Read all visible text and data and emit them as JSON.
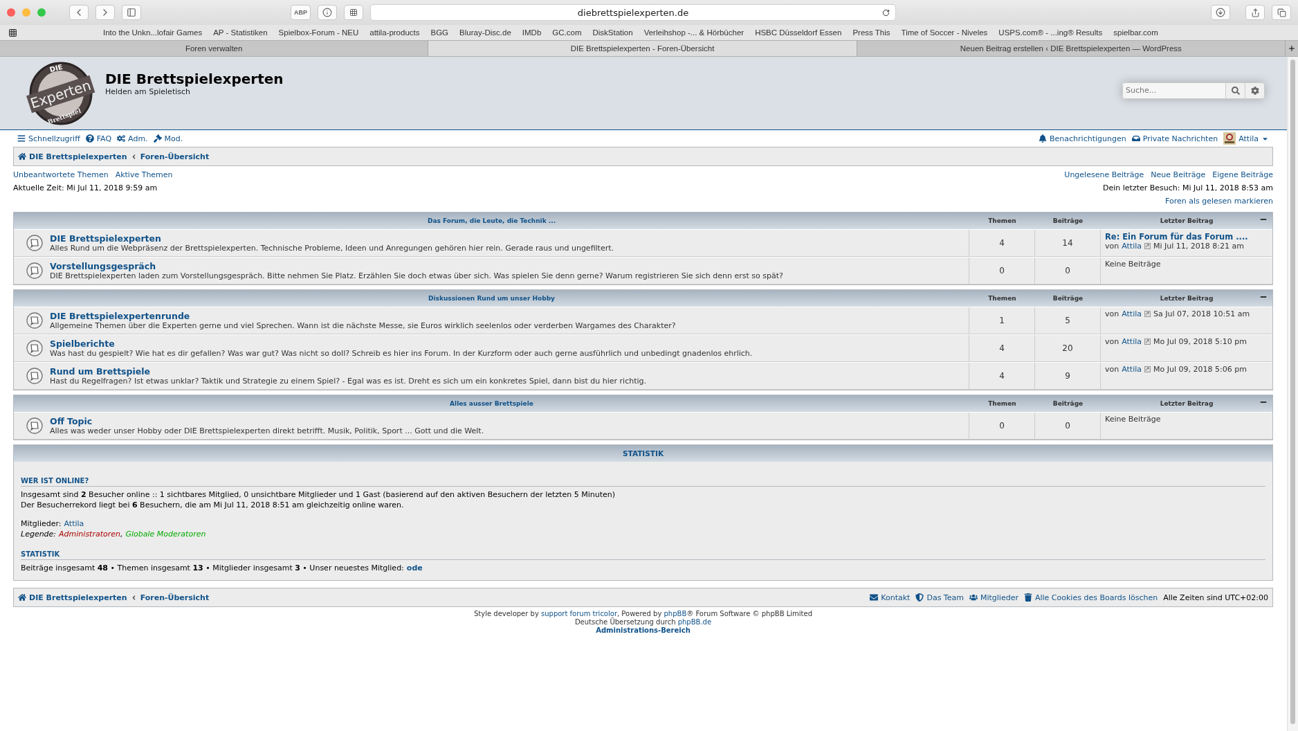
{
  "browser": {
    "url": "diebrettspielexperten.de",
    "adblock": "ABP",
    "bookmarks": [
      "Into the Unkn...lofair Games",
      "AP - Statistiken",
      "Spielbox-Forum - NEU",
      "attila-products",
      "BGG",
      "Bluray-Disc.de",
      "IMDb",
      "GC.com",
      "DiskStation",
      "Verleihshop -... & Hörbücher",
      "HSBC Düsseldorf Essen",
      "Press This",
      "Time of Soccer - Niveles",
      "USPS.com® - ...ing® Results",
      "spielbar.com"
    ],
    "tabs": [
      {
        "label": "Foren verwalten",
        "selected": false
      },
      {
        "label": "DIE Brettspielexperten - Foren-Übersicht",
        "selected": true
      },
      {
        "label": "Neuen Beitrag erstellen ‹ DIE Brettspielexperten — WordPress",
        "selected": false
      }
    ]
  },
  "header": {
    "logo": {
      "top": "DIE",
      "main": "Experten",
      "bottom": "Brettspiel"
    },
    "title": "DIE Brettspielexperten",
    "subtitle": "Helden am Spieletisch",
    "search": {
      "placeholder": "Suche..."
    }
  },
  "nav": {
    "left": [
      {
        "kind": "menu",
        "label": "Schnellzugriff"
      },
      {
        "kind": "faq",
        "label": "FAQ"
      },
      {
        "kind": "admin",
        "label": "Adm."
      },
      {
        "kind": "mod",
        "label": "Mod."
      }
    ],
    "right": [
      {
        "kind": "bell",
        "label": "Benachrichtigungen"
      },
      {
        "kind": "inbox",
        "label": "Private Nachrichten"
      }
    ],
    "user": "Attila"
  },
  "breadcrumb": [
    "DIE Brettspielexperten",
    "Foren-Übersicht"
  ],
  "quick_links_left": [
    "Unbeantwortete Themen",
    "Aktive Themen"
  ],
  "quick_links_right": [
    "Ungelesene Beiträge",
    "Neue Beiträge",
    "Eigene Beiträge"
  ],
  "current_time": "Aktuelle Zeit: Mi Jul 11, 2018 9:59 am",
  "last_visit": "Dein letzter Besuch: Mi Jul 11, 2018 8:53 am",
  "mark_read": "Foren als gelesen markieren",
  "categories": [
    {
      "title": "Das Forum, die Leute, die Technik ...",
      "columns": [
        "Themen",
        "Beiträge",
        "Letzter Beitrag"
      ],
      "forums": [
        {
          "name": "DIE Brettspielexperten",
          "description": "Alles Rund um die Webpräsenz der Brettspielexperten. Technische Probleme, Ideen und Anregungen gehören hier rein. Gerade raus und ungefiltert.",
          "topics": "4",
          "posts": "14",
          "last_post": {
            "kind": "post",
            "title": "Re: Ein Forum für das Forum ....",
            "by": "von",
            "author": "Attila",
            "date": "Mi Jul 11, 2018 8:21 am"
          }
        },
        {
          "name": "Vorstellungsgespräch",
          "description": "DIE Brettspielexperten laden zum Vorstellungsgespräch. Bitte nehmen Sie Platz. Erzählen Sie doch etwas über sich. Was spielen Sie denn gerne? Warum registrieren Sie sich denn erst so spät?",
          "topics": "0",
          "posts": "0",
          "last_post": {
            "kind": "none",
            "text": "Keine Beiträge"
          }
        }
      ]
    },
    {
      "title": "Diskussionen Rund um unser Hobby",
      "columns": [
        "Themen",
        "Beiträge",
        "Letzter Beitrag"
      ],
      "forums": [
        {
          "name": "DIE Brettspielexpertenrunde",
          "description": "Allgemeine Themen über die Experten gerne und viel Sprechen. Wann ist die nächste Messe, sie Euros wirklich seelenlos oder verderben Wargames des Charakter?",
          "topics": "1",
          "posts": "5",
          "last_post": {
            "kind": "post",
            "by": "von",
            "author": "Attila",
            "date": "Sa Jul 07, 2018 10:51 am"
          }
        },
        {
          "name": "Spielberichte",
          "description": "Was hast du gespielt? Wie hat es dir gefallen? Was war gut? Was nicht so doll? Schreib es hier ins Forum. In der Kurzform oder auch gerne ausführlich und unbedingt gnadenlos ehrlich.",
          "topics": "4",
          "posts": "20",
          "last_post": {
            "kind": "post",
            "by": "von",
            "author": "Attila",
            "date": "Mo Jul 09, 2018 5:10 pm"
          }
        },
        {
          "name": "Rund um Brettspiele",
          "description": "Hast du Regelfragen? Ist etwas unklar? Taktik und Strategie zu einem Spiel? - Egal was es ist. Dreht es sich um ein konkretes Spiel, dann bist du hier richtig.",
          "topics": "4",
          "posts": "9",
          "last_post": {
            "kind": "post",
            "by": "von",
            "author": "Attila",
            "date": "Mo Jul 09, 2018 5:06 pm"
          }
        }
      ]
    },
    {
      "title": "Alles ausser Brettspiele",
      "columns": [
        "Themen",
        "Beiträge",
        "Letzter Beitrag"
      ],
      "forums": [
        {
          "name": "Off Topic",
          "description": "Alles was weder unser Hobby oder DIE Brettspielexperten direkt betrifft. Musik, Politik, Sport ... Gott und die Welt.",
          "topics": "0",
          "posts": "0",
          "last_post": {
            "kind": "none",
            "text": "Keine Beiträge"
          }
        }
      ]
    }
  ],
  "statistics": {
    "title": "STATISTIK",
    "online_heading": "WER IST ONLINE?",
    "online_text": "Insgesamt sind **2** Besucher online :: 1 sichtbares Mitglied, 0 unsichtbare Mitglieder und 1 Gast (basierend auf den aktiven Besuchern der letzten 5 Minuten)",
    "record_text": "Der Besucherrekord liegt bei **6** Besuchern, die am Mi Jul 11, 2018 8:51 am gleichzeitig online waren.",
    "members_label": "Mitglieder:",
    "members": [
      "Attila"
    ],
    "legend_label": "Legende:",
    "legend_separator": ",",
    "legend": [
      {
        "name": "Administratoren",
        "color": "#aa0000"
      },
      {
        "name": "Globale Moderatoren",
        "color": "#00aa00"
      }
    ],
    "stats_heading": "STATISTIK",
    "stats_text": "Beiträge insgesamt **48** • Themen insgesamt **13** • Mitglieder insgesamt **3** • Unser neuestes Mitglied:",
    "newest_member": "ode"
  },
  "footer": {
    "breadcrumb": [
      "DIE Brettspielexperten",
      "Foren-Übersicht"
    ],
    "links": [
      {
        "kind": "mail",
        "label": "Kontakt"
      },
      {
        "kind": "shield",
        "label": "Das Team"
      },
      {
        "kind": "users",
        "label": "Mitglieder"
      },
      {
        "kind": "trash",
        "label": "Alle Cookies des Boards löschen"
      }
    ],
    "timezone": "Alle Zeiten sind UTC+02:00"
  },
  "credits": {
    "lines": [
      [
        {
          "text": "Style developer by "
        },
        {
          "text": "support forum tricolor",
          "link": true
        },
        {
          "text": ", Powered by "
        },
        {
          "text": "phpBB",
          "link": true
        },
        {
          "text": "® Forum Software © phpBB Limited"
        }
      ],
      [
        {
          "text": "Deutsche Übersetzung durch "
        },
        {
          "text": "phpBB.de",
          "link": true
        }
      ]
    ],
    "admin": "Administrations-Bereich"
  }
}
